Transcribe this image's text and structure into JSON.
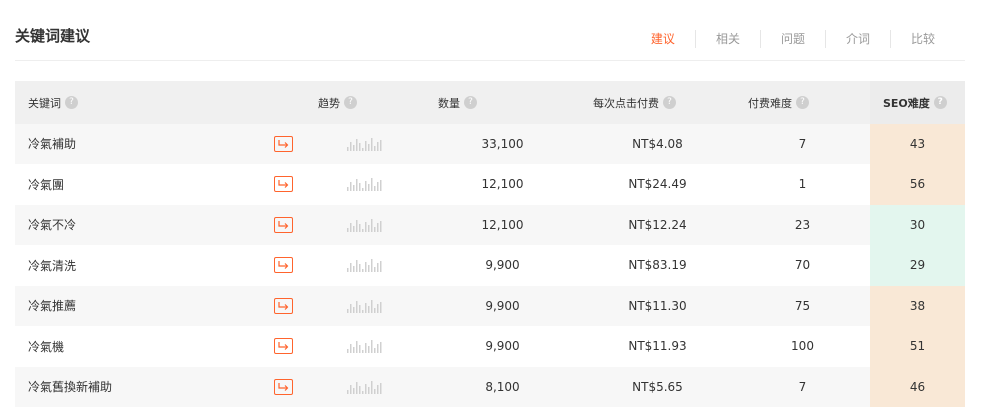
{
  "page_title": "关键词建议",
  "tabs": [
    {
      "label": "建议",
      "active": true
    },
    {
      "label": "相关",
      "active": false
    },
    {
      "label": "问题",
      "active": false
    },
    {
      "label": "介词",
      "active": false
    },
    {
      "label": "比较",
      "active": false
    }
  ],
  "columns": {
    "keyword": "关键词",
    "trend": "趋势",
    "volume": "数量",
    "cpc": "每次点击付费",
    "paid_difficulty": "付费难度",
    "seo_difficulty": "SEO难度"
  },
  "help_icon_glyph": "?",
  "rows": [
    {
      "keyword": "冷氣補助",
      "volume": "33,100",
      "cpc": "NT$4.08",
      "paid_difficulty": "7",
      "seo_difficulty": "43",
      "seo_color": "orange"
    },
    {
      "keyword": "冷氣團",
      "volume": "12,100",
      "cpc": "NT$24.49",
      "paid_difficulty": "1",
      "seo_difficulty": "56",
      "seo_color": "orange"
    },
    {
      "keyword": "冷氣不冷",
      "volume": "12,100",
      "cpc": "NT$12.24",
      "paid_difficulty": "23",
      "seo_difficulty": "30",
      "seo_color": "green"
    },
    {
      "keyword": "冷氣清洗",
      "volume": "9,900",
      "cpc": "NT$83.19",
      "paid_difficulty": "70",
      "seo_difficulty": "29",
      "seo_color": "green"
    },
    {
      "keyword": "冷氣推薦",
      "volume": "9,900",
      "cpc": "NT$11.30",
      "paid_difficulty": "75",
      "seo_difficulty": "38",
      "seo_color": "orange"
    },
    {
      "keyword": "冷氣機",
      "volume": "9,900",
      "cpc": "NT$11.93",
      "paid_difficulty": "100",
      "seo_difficulty": "51",
      "seo_color": "orange"
    },
    {
      "keyword": "冷氣舊換新補助",
      "volume": "8,100",
      "cpc": "NT$5.65",
      "paid_difficulty": "7",
      "seo_difficulty": "46",
      "seo_color": "orange"
    }
  ],
  "colors": {
    "accent": "#ff642d",
    "seo_orange": "#f9e8d6",
    "seo_green": "#e3f6ee",
    "trend_bar": "#d0d0d0"
  },
  "icons": {
    "keyword_action": "arrow-turn-right-icon",
    "help": "question-circle-icon",
    "trend": "mini-bar-chart-icon"
  }
}
